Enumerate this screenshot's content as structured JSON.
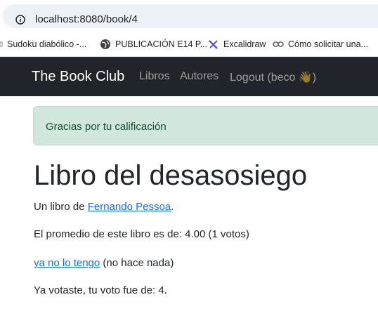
{
  "browser": {
    "url": "localhost:8080/book/4",
    "bookmarks": [
      {
        "label": "Sudoku diabólico -...",
        "icon": "page-icon"
      },
      {
        "label": "PUBLICACIÓN E14 P...",
        "icon": "globe-icon"
      },
      {
        "label": "Excalidraw",
        "icon": "excalidraw-icon"
      },
      {
        "label": "Cómo solicitar una...",
        "icon": "link-icon"
      }
    ]
  },
  "navbar": {
    "brand": "The Book Club",
    "links": [
      "Libros",
      "Autores",
      "Logout (beco 👋)"
    ]
  },
  "alert": {
    "message": "Gracias por tu calificación"
  },
  "book": {
    "title": "Libro del desasosiego",
    "author_prefix": "Un libro de ",
    "author": "Fernando Pessoa",
    "author_suffix": ".",
    "average_text": "El promedio de este libro es de: 4.00 (1 votos)",
    "action_link": "ya no lo tengo",
    "action_note": " (no hace nada)",
    "vote_text": "Ya votaste, tu voto fue de: 4."
  },
  "colors": {
    "navbar_bg": "#212529",
    "alert_bg": "#d1e7dd",
    "alert_text": "#0f5132",
    "link": "#0d6efd"
  }
}
